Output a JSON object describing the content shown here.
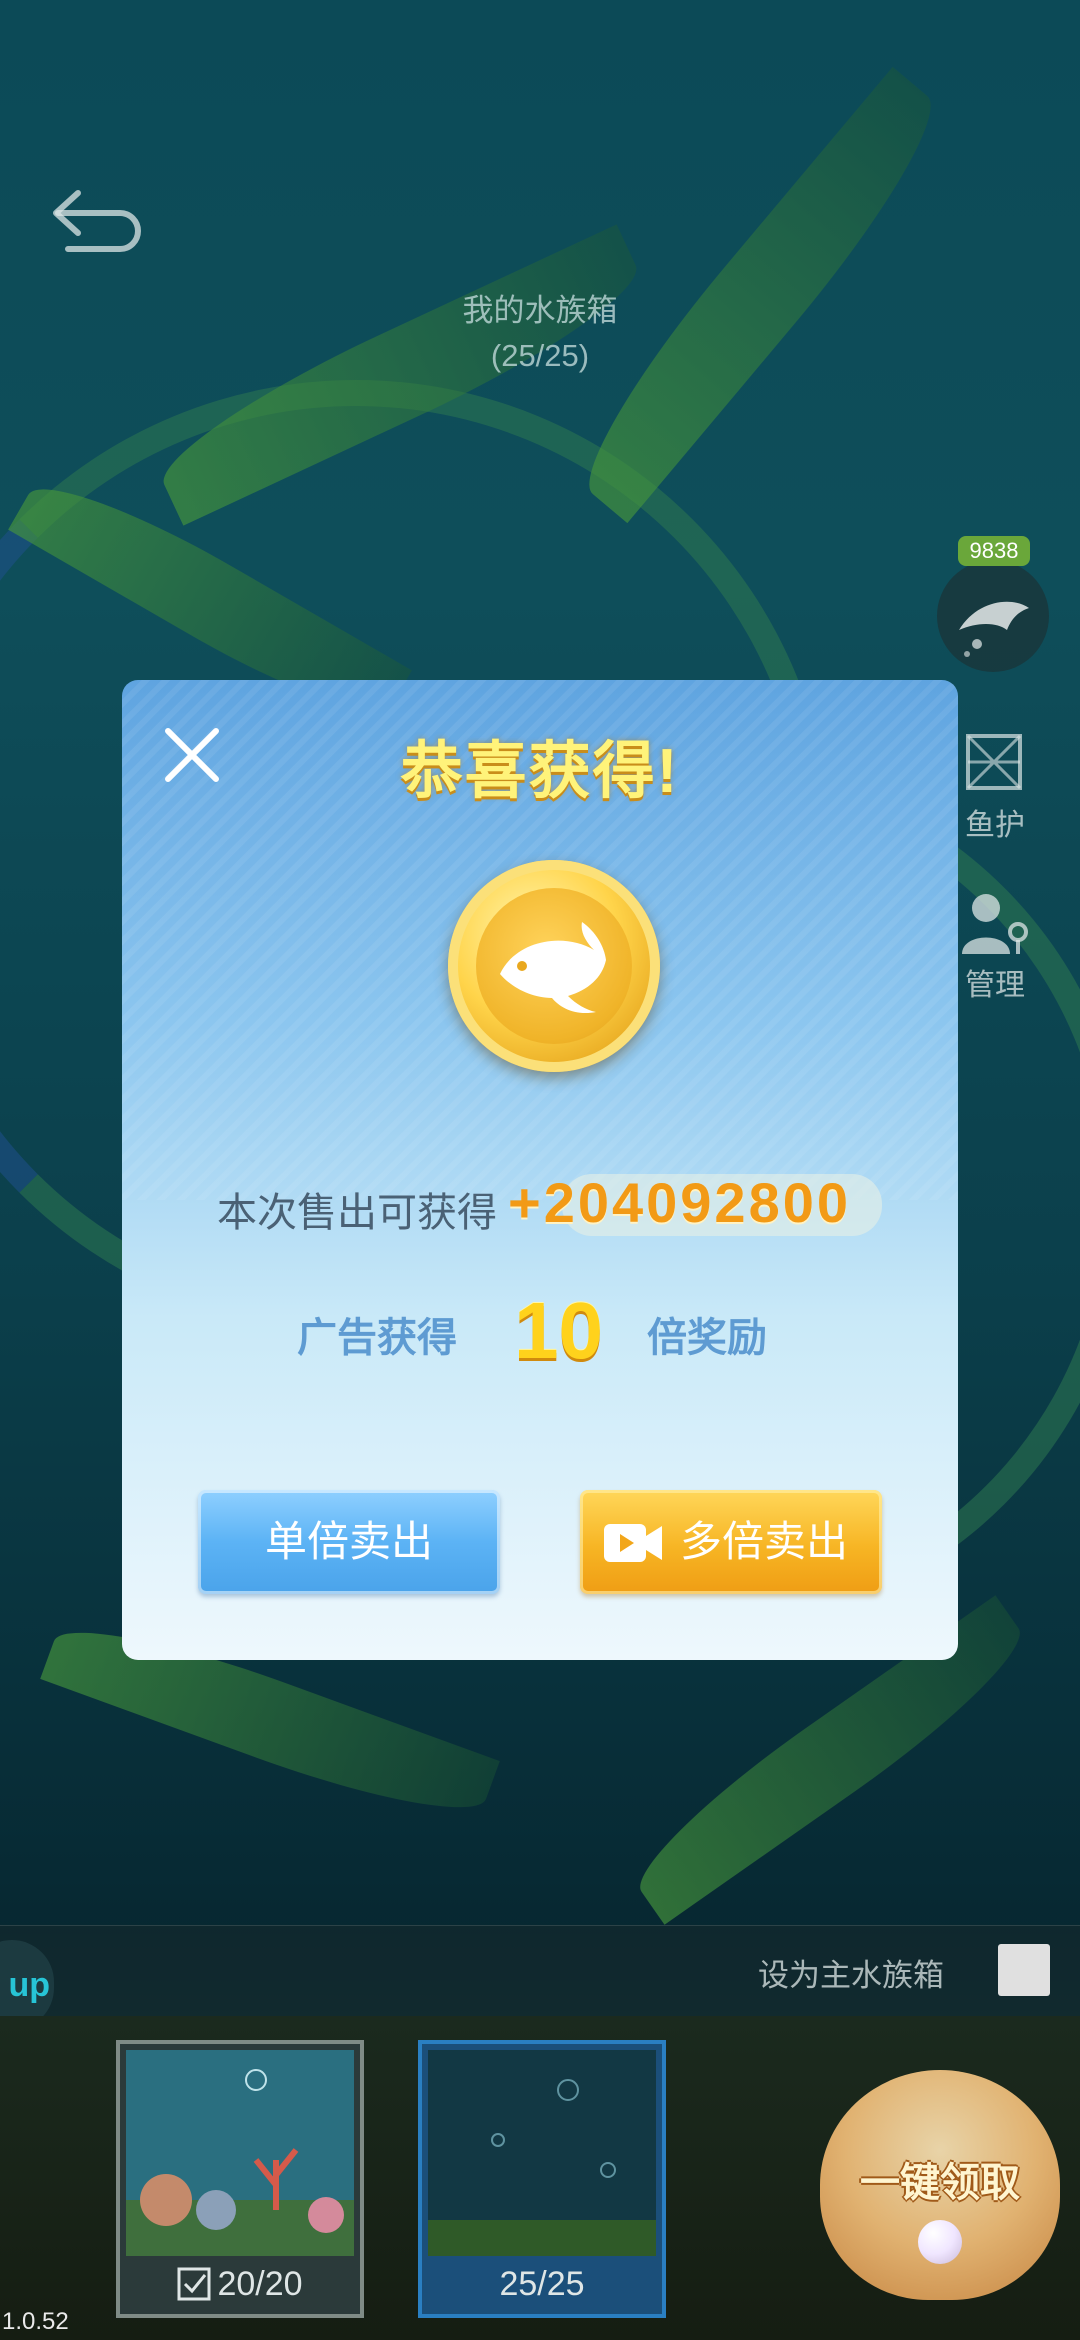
{
  "aquarium": {
    "title": "我的水族箱",
    "count": "(25/25)"
  },
  "side": {
    "fish_count": "9838",
    "fish_care_label": "鱼护",
    "manage_label": "管理"
  },
  "modal": {
    "title": "恭喜获得!",
    "sell_label": "本次售出可获得",
    "sell_amount": "+204092800",
    "ad_text_left": "广告获得",
    "ad_multiplier": "10",
    "ad_text_right": "倍奖励",
    "single_sell_button": "单倍卖出",
    "multi_sell_button": "多倍卖出"
  },
  "bottom": {
    "up_label": "up",
    "set_main_label": "设为主水族箱",
    "tanks": [
      {
        "caption": "20/20",
        "selected": false
      },
      {
        "caption": "25/25",
        "selected": true
      }
    ],
    "claim_label": "一键领取"
  },
  "version": "1.0.52",
  "colors": {
    "modal_title": "#fff37a",
    "sell_amount": "#f29a16",
    "single_button": "#5cb3f5",
    "multi_button": "#f7b524"
  },
  "icons": [
    "back-icon",
    "fish-icon",
    "net-icon",
    "manage-icon",
    "close-icon",
    "coin-fish-icon",
    "video-icon",
    "check-icon",
    "pearl-icon"
  ]
}
